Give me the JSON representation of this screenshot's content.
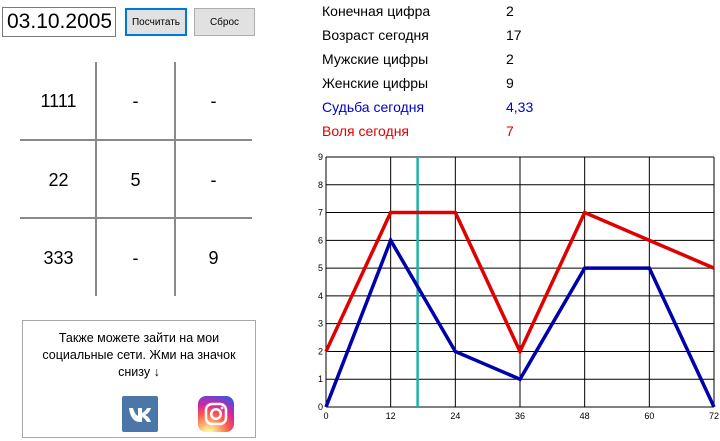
{
  "input": {
    "date_value": "03.10.2005"
  },
  "buttons": {
    "calc_label": "Посчитать",
    "reset_label": "Сброс"
  },
  "grid": {
    "cells": [
      [
        "1111",
        "-",
        "-"
      ],
      [
        "22",
        "5",
        "-"
      ],
      [
        "333",
        "-",
        "9"
      ]
    ]
  },
  "stats": [
    {
      "label": "Конечная цифра",
      "value": "2"
    },
    {
      "label": "Возраст сегодня",
      "value": "17"
    },
    {
      "label": "Мужские цифры",
      "value": "2"
    },
    {
      "label": "Женские цифры",
      "value": "9"
    },
    {
      "label": "Судьба сегодня",
      "value": "4,33",
      "color": "#0000cc"
    },
    {
      "label": "Воля сегодня",
      "value": "7",
      "color": "#e00000"
    }
  ],
  "social": {
    "text": "Также можете зайти на мои социальные сети. Жми на значок снизу ↓",
    "icons": [
      "vk-icon",
      "instagram-icon"
    ]
  },
  "chart_data": {
    "type": "line",
    "x": [
      0,
      12,
      24,
      36,
      48,
      60,
      72
    ],
    "x_ticks": [
      0,
      12,
      24,
      36,
      48,
      60,
      72
    ],
    "y_ticks": [
      0,
      1,
      2,
      3,
      4,
      5,
      6,
      7,
      8,
      9
    ],
    "xlim": [
      0,
      72
    ],
    "ylim": [
      0,
      9
    ],
    "grid": true,
    "series": [
      {
        "values": [
          2,
          7,
          7,
          2,
          7,
          6,
          5
        ],
        "color": "#e00000"
      },
      {
        "values": [
          0,
          6,
          2,
          1,
          5,
          5,
          0
        ],
        "color": "#0000aa"
      }
    ],
    "marker_x": 17,
    "marker_color": "#20b2aa"
  }
}
